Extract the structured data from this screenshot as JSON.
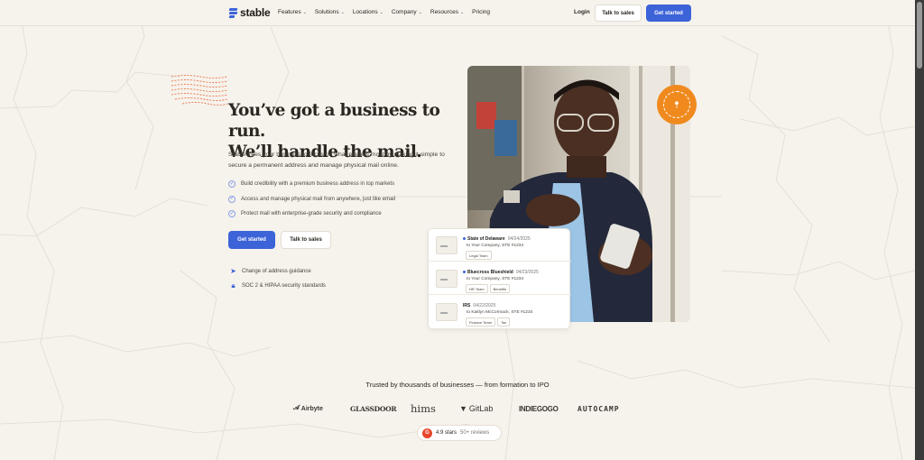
{
  "nav": {
    "brand": "stable",
    "menu": [
      {
        "label": "Features",
        "has_dropdown": true
      },
      {
        "label": "Solutions",
        "has_dropdown": true
      },
      {
        "label": "Locations",
        "has_dropdown": true
      },
      {
        "label": "Company",
        "has_dropdown": true
      },
      {
        "label": "Resources",
        "has_dropdown": true
      },
      {
        "label": "Pricing",
        "has_dropdown": false
      }
    ],
    "login": "Login",
    "talk_to_sales": "Talk to sales",
    "get_started": "Get started"
  },
  "hero": {
    "title_line1": "You’ve got a business to run.",
    "title_line2": "We’ll handle the mail.",
    "subtitle": "Stable frees your business to focus on what matters most by making it simple to secure a permanent address and manage physical mail online.",
    "bullets": [
      "Build credibility with a premium business address in top markets",
      "Access and manage physical mail from anywhere, just like email",
      "Protect mail with enterprise-grade security and compliance"
    ],
    "cta_primary": "Get started",
    "cta_secondary": "Talk to sales",
    "features": [
      {
        "icon": "cursor-arrow-icon",
        "label": "Change of address guidance"
      },
      {
        "icon": "shield-lock-icon",
        "label": "SOC 2 & HIPAA security standards"
      }
    ]
  },
  "mail_card": {
    "items": [
      {
        "from": "State of Delaware",
        "date": "04/24/2025",
        "to": "to Your Company, STE #1234",
        "tags": [
          "Legal Team"
        ]
      },
      {
        "from": "Bluecross Blueshield",
        "date": "04/23/2025",
        "to": "to Your Company, STE #1234",
        "tags": [
          "HR Team",
          "Benefits"
        ]
      },
      {
        "from": "IRS",
        "date": "04/22/2025",
        "to": "to Kaitlyn McCormack, STE #1234",
        "tags": [
          "Finance Team",
          "Tax"
        ]
      }
    ]
  },
  "trust": {
    "heading": "Trusted by thousands of businesses — from formation to IPO",
    "logos": [
      "Airbyte",
      "GLASSDOOR",
      "hims",
      "GitLab",
      "INDIEGOGO",
      "AUTOCAMP"
    ],
    "review_icon": "G",
    "rating": "4.9 stars",
    "reviews": "50+ reviews"
  },
  "colors": {
    "accent": "#3c63d8",
    "background": "#f6f2ec",
    "badge": "#f08a1e",
    "text": "#2b2620"
  }
}
